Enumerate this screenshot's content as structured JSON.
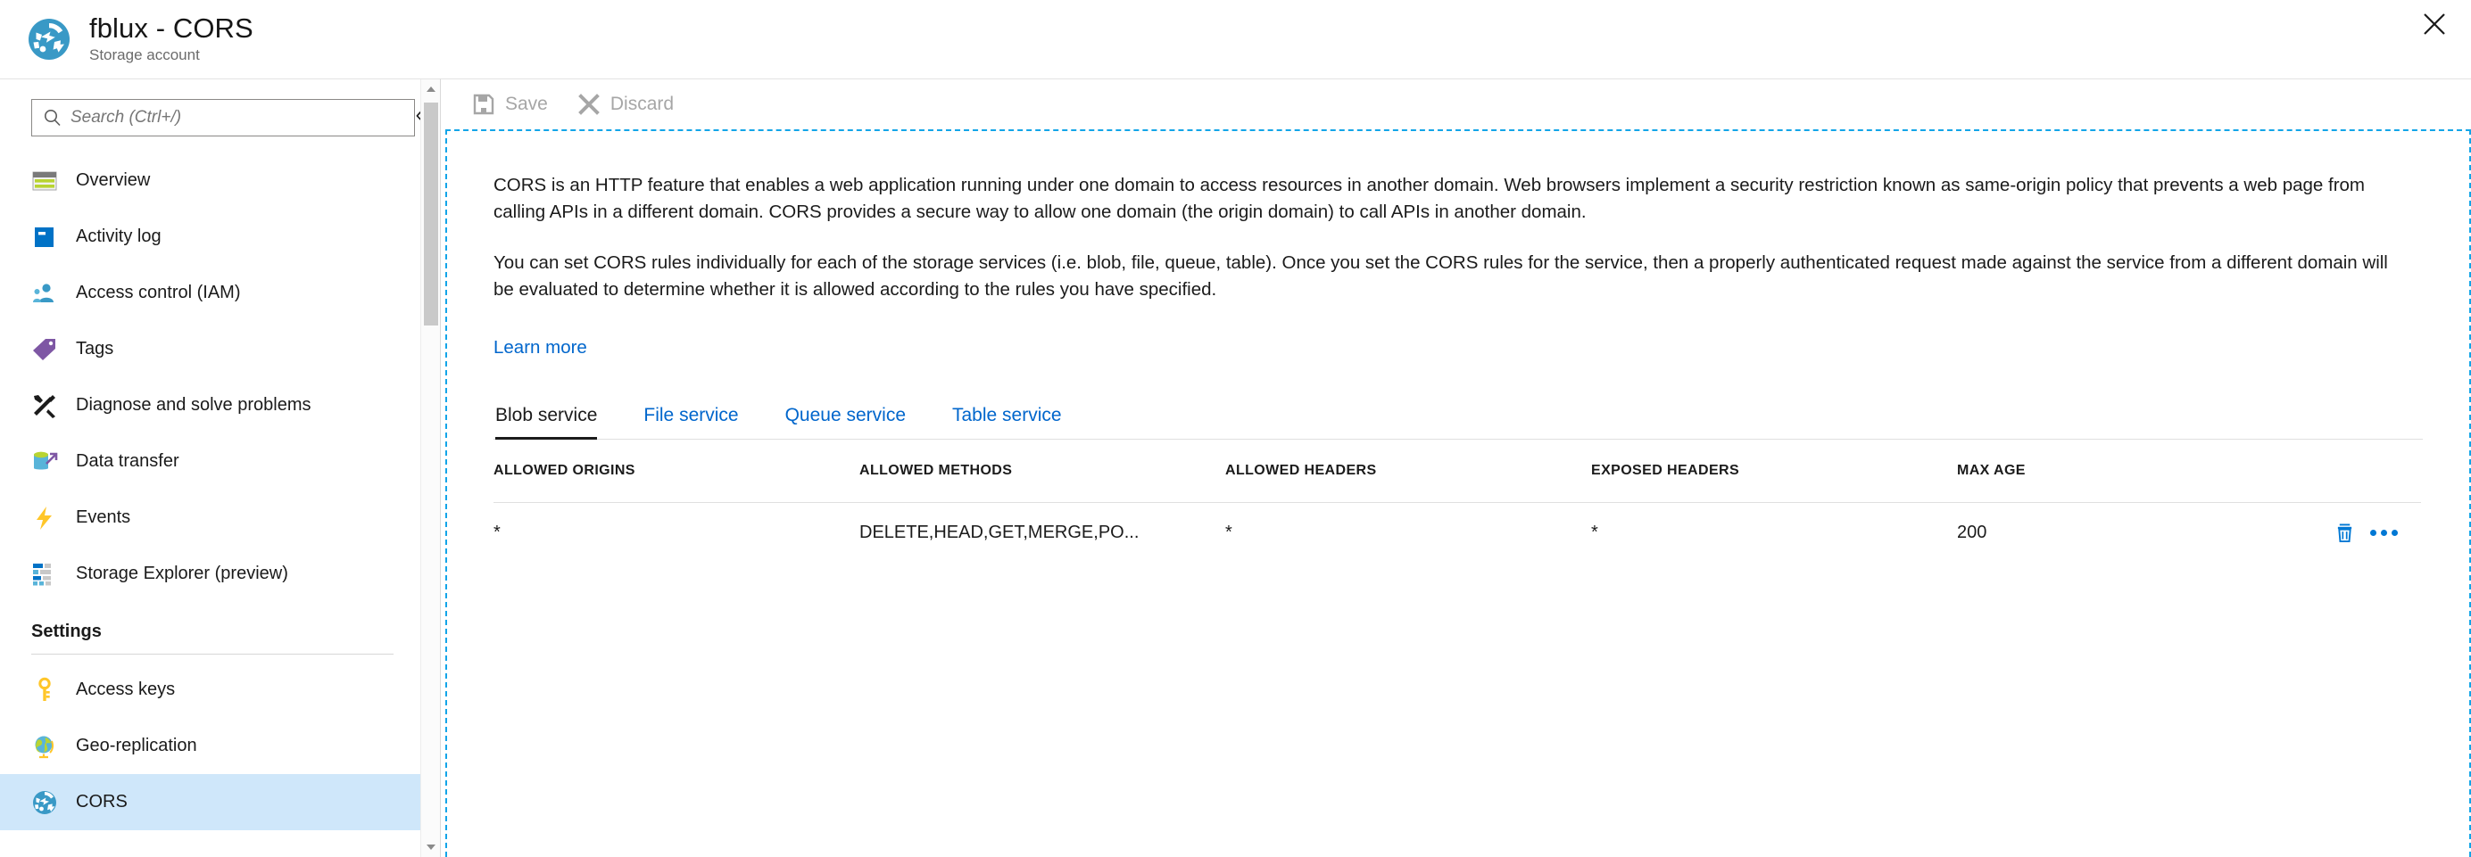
{
  "header": {
    "title": "fblux - CORS",
    "subtitle": "Storage account",
    "resource_icon": "cors-storage-icon",
    "close_icon": "close-icon"
  },
  "sidebar": {
    "search": {
      "placeholder": "Search (Ctrl+/)",
      "value": "",
      "icon": "search-icon"
    },
    "collapse_icon": "«",
    "items": [
      {
        "label": "Overview",
        "icon": "overview-icon",
        "active": false
      },
      {
        "label": "Activity log",
        "icon": "activity-log-icon",
        "active": false
      },
      {
        "label": "Access control (IAM)",
        "icon": "access-control-icon",
        "active": false
      },
      {
        "label": "Tags",
        "icon": "tags-icon",
        "active": false
      },
      {
        "label": "Diagnose and solve problems",
        "icon": "diagnose-icon",
        "active": false
      },
      {
        "label": "Data transfer",
        "icon": "data-transfer-icon",
        "active": false
      },
      {
        "label": "Events",
        "icon": "events-icon",
        "active": false
      },
      {
        "label": "Storage Explorer (preview)",
        "icon": "storage-explorer-icon",
        "active": false
      }
    ],
    "settings_section": {
      "title": "Settings",
      "items": [
        {
          "label": "Access keys",
          "icon": "key-icon",
          "active": false
        },
        {
          "label": "Geo-replication",
          "icon": "globe-icon",
          "active": false
        },
        {
          "label": "CORS",
          "icon": "cors-icon",
          "active": true
        }
      ]
    }
  },
  "toolbar": {
    "save_label": "Save",
    "save_icon": "save-icon",
    "save_enabled": false,
    "discard_label": "Discard",
    "discard_icon": "discard-icon",
    "discard_enabled": false
  },
  "main": {
    "paragraph1": "CORS is an HTTP feature that enables a web application running under one domain to access resources in another domain. Web browsers implement a security restriction known as same-origin policy that prevents a web page from calling APIs in a different domain. CORS provides a secure way to allow one domain (the origin domain) to call APIs in another domain.",
    "paragraph2": "You can set CORS rules individually for each of the storage services (i.e. blob, file, queue, table). Once you set the CORS rules for the service, then a properly authenticated request made against the service from a different domain will be evaluated to determine whether it is allowed according to the rules you have specified.",
    "learn_more": "Learn more",
    "tabs": [
      {
        "label": "Blob service",
        "active": true
      },
      {
        "label": "File service",
        "active": false
      },
      {
        "label": "Queue service",
        "active": false
      },
      {
        "label": "Table service",
        "active": false
      }
    ],
    "table": {
      "columns": [
        "ALLOWED ORIGINS",
        "ALLOWED METHODS",
        "ALLOWED HEADERS",
        "EXPOSED HEADERS",
        "MAX AGE"
      ],
      "rows": [
        {
          "allowed_origins": "*",
          "allowed_methods": "DELETE,HEAD,GET,MERGE,PO...",
          "allowed_headers": "*",
          "exposed_headers": "*",
          "max_age": "200",
          "delete_icon": "trash-icon",
          "more_icon": "ellipsis-icon"
        }
      ]
    }
  },
  "colors": {
    "accent_blue": "#0078d4",
    "link_blue": "#0066cc",
    "selected_row": "#cfe7fa",
    "focus_dashed": "#12a5e8"
  }
}
